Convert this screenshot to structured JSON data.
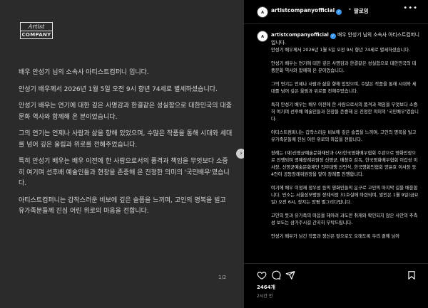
{
  "post_image": {
    "logo_line1": "Artist",
    "logo_line2": "COMPANY",
    "paragraphs": [
      "배우 안성기 님의 소속사 아티스트컴퍼니 입니다.",
      "안성기 배우께서 2026년 1월 5일 오전 9시 향년 74세로 별세하셨습니다.",
      "안성기 배우는 연기에 대한 깊은 사명감과 한결같은 성실함으로 대한민국의 대중문화 역사와 함께해 온 분이었습니다.",
      "그의 연기는 언제나 사람과 삶을 향해 있었으며, 수많은 작품을 통해 시대와 세대를 넘어 깊은 울림과 위로를 전해주었습니다.",
      "특히 안성기 배우는 배우 이전에 한 사람으로서의 품격과 책임을 무엇보다 소중히 여기며 선후배 예술인들과 현장을 존중해 온 진정한 의미의 '국민배우'였습니다.",
      "아티스트컴퍼니는 갑작스러운 비보에 깊은 슬픔을 느끼며, 고인의 명복을 빌고 유가족분들께 진심 어린 위로의 마음을 전합니다."
    ],
    "page_indicator": "1/2"
  },
  "header": {
    "username": "artistcompanyofficial",
    "separator": "•",
    "follow_label": "팔로잉",
    "more_label": "•••"
  },
  "caption": {
    "username": "artistcompanyofficial",
    "intro": "배우 안성기 님의 소속사 아티스트컴퍼니 입니다.",
    "paragraphs": [
      "안성기 배우께서 2026년 1월 5일 오전 9시 향년 74세로 별세하셨습니다.",
      "안성기 배우는 연기에 대한 깊은 사명감과 한결같은 성실함으로 대한민국의 대중문화 역사와 함께해 온 분이었습니다.",
      "그의 연기는 언제나 사람과 삶을 향해 있었으며, 수많은 작품을 통해 시대와 세대를 넘어 깊은 울림과 위로를 전해주었습니다.",
      "특히 안성기 배우는 배우 이전에 한 사람으로서의 품격과 책임을 무엇보다 소중히 여기며 선후배 예술인들과 현장을 존중해 온 진정한 의미의 '국민배우'였습니다.",
      "아티스트컴퍼니는 갑작스러운 비보에 깊은 슬픔을 느끼며, 고인의 명복을 빌고 유가족분들께 진심 어린 위로의 마음을 전합니다.",
      "장례는 (재)신영균예술문화재단과 (사)한국영화배우협회 주관으로 영화인장으로 진행되며 명예장례위원장 신영균, 배창호 감독, 한국영화배우협회 이갑성 이사장, 신영균예술문화재단 직무대행 신언식, 한국영화인협회 양윤호 이사장 등 4인이 공동장례위원장을 맡아 장례를 진행합니다.",
      "여기에 배우 이정재 정우성 등의 영화인들의 운구로 고인의 마지막 길을 배웅합니다. 빈소는 서울성모병원 장례식장 31호실에 마련되며, 발인은 1월 9일(금요일) 오전 6시, 장지는 양평 별그리다입니다.",
      "고인의 뜻과 유가족의 마음을 헤아려 과도한 취재와 확인되지 않은 사안의 추측성 보도는 삼가주시길 간곡히 부탁드립니다.",
      "안성기 배우가 남긴 작품과 정신은 앞으로도 오래도록 우리 곁에 남아"
    ]
  },
  "engagement": {
    "likes": "2464개",
    "likes_suffix": "",
    "time": "2시간 전"
  },
  "colors": {
    "verified": "#3897f0",
    "image_bg": "#2b2b2b",
    "panel_bg": "#000000"
  },
  "icons": [
    "heart-icon",
    "comment-icon",
    "share-icon",
    "bookmark-icon",
    "chevron-right-icon",
    "more-icon",
    "verified-icon"
  ]
}
